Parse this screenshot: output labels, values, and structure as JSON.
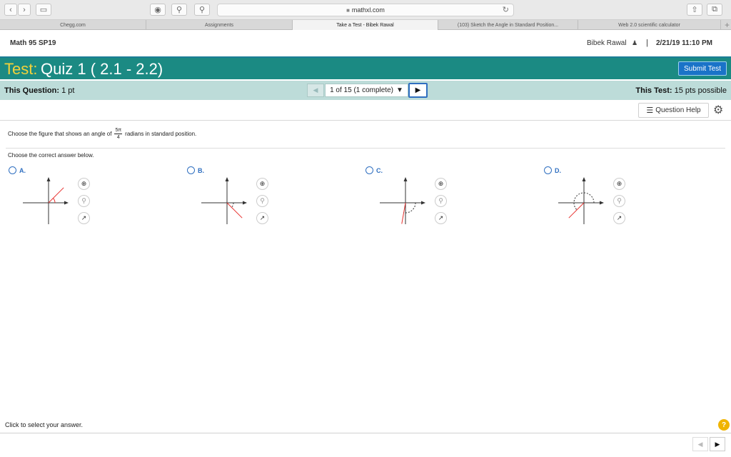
{
  "browser": {
    "url": "mathxl.com",
    "lock_icon": "lock-icon",
    "tabs": [
      {
        "label": "Chegg.com",
        "active": false
      },
      {
        "label": "Assignments",
        "active": false
      },
      {
        "label": "Take a Test - Bibek Rawal",
        "active": true
      },
      {
        "label": "(103) Sketch the Angle in Standard Position...",
        "active": false
      },
      {
        "label": "Web 2.0 scientific calculator",
        "active": false
      }
    ]
  },
  "course": {
    "title": "Math 95 SP19",
    "user": "Bibek Rawal",
    "separator": "|",
    "datetime": "2/21/19 11:10 PM"
  },
  "test": {
    "label": "Test:",
    "name": "Quiz 1 ( 2.1 - 2.2)",
    "submit_label": "Submit Test"
  },
  "question_bar": {
    "this_question_label": "This Question:",
    "this_question_value": "1 pt",
    "selector": "1 of 15 (1 complete)",
    "this_test_label": "This Test:",
    "this_test_value": "15 pts possible"
  },
  "help": {
    "label": "Question Help"
  },
  "question": {
    "prompt_before": "Choose the figure that shows an angle of",
    "fraction_num": "5π",
    "fraction_den": "4",
    "prompt_after": "radians in standard position.",
    "instruction": "Choose the correct answer below."
  },
  "options": [
    {
      "letter": "A.",
      "terminal_angle_deg": 45
    },
    {
      "letter": "B.",
      "terminal_angle_deg": -45
    },
    {
      "letter": "C.",
      "terminal_angle_deg": -100
    },
    {
      "letter": "D.",
      "terminal_angle_deg": 225
    }
  ],
  "footer": {
    "status_text": "Click to select your answer.",
    "help_symbol": "?"
  },
  "colors": {
    "title_bar": "#1b8a83",
    "test_label": "#f3d13a",
    "question_bar": "#bddcd9",
    "submit_button": "#1a73c8",
    "angle_line": "#e8322f",
    "accent_blue": "#2f6fc0"
  }
}
